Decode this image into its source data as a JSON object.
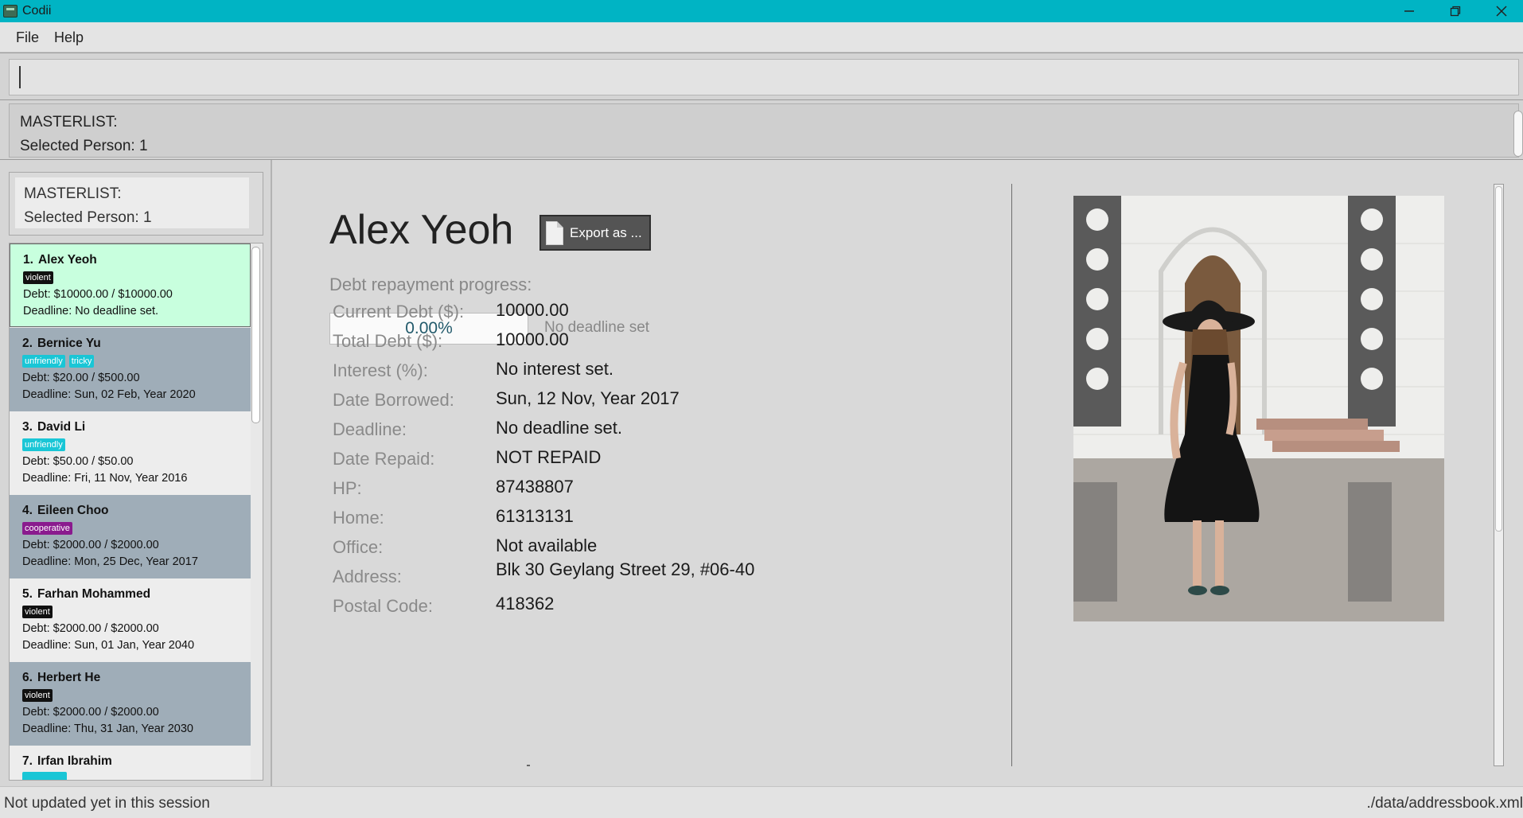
{
  "window": {
    "title": "Codii"
  },
  "menu": {
    "file": "File",
    "help": "Help"
  },
  "command": {
    "value": ""
  },
  "result": {
    "line1": "MASTERLIST:",
    "line2": "Selected Person: 1"
  },
  "mini_result": {
    "line1": "MASTERLIST:",
    "line2": "Selected Person: 1"
  },
  "persons": [
    {
      "index": "1.",
      "name": "Alex Yeoh",
      "tags": [
        {
          "label": "violent",
          "color": "#111111"
        }
      ],
      "debt": "Debt: $10000.00 / $10000.00",
      "deadline": "Deadline: No deadline set."
    },
    {
      "index": "2.",
      "name": "Bernice Yu",
      "tags": [
        {
          "label": "unfriendly",
          "color": "#19c6d6"
        },
        {
          "label": "tricky",
          "color": "#19c6d6"
        }
      ],
      "debt": "Debt: $20.00 / $500.00",
      "deadline": "Deadline: Sun, 02 Feb, Year 2020"
    },
    {
      "index": "3.",
      "name": "David Li",
      "tags": [
        {
          "label": "unfriendly",
          "color": "#19c6d6"
        }
      ],
      "debt": "Debt: $50.00 / $50.00",
      "deadline": "Deadline: Fri, 11 Nov, Year 2016"
    },
    {
      "index": "4.",
      "name": "Eileen Choo",
      "tags": [
        {
          "label": "cooperative",
          "color": "#8a1a8e"
        }
      ],
      "debt": "Debt: $2000.00 / $2000.00",
      "deadline": "Deadline: Mon, 25 Dec, Year 2017"
    },
    {
      "index": "5.",
      "name": "Farhan Mohammed",
      "tags": [
        {
          "label": "violent",
          "color": "#111111"
        }
      ],
      "debt": "Debt: $2000.00 / $2000.00",
      "deadline": "Deadline: Sun, 01 Jan, Year 2040"
    },
    {
      "index": "6.",
      "name": "Herbert He",
      "tags": [
        {
          "label": "violent",
          "color": "#111111"
        }
      ],
      "debt": "Debt: $2000.00 / $2000.00",
      "deadline": "Deadline: Thu, 31 Jan, Year 2030"
    },
    {
      "index": "7.",
      "name": "Irfan Ibrahim",
      "tags": [
        {
          "label": "",
          "color": "#19c6d6"
        }
      ],
      "debt": "",
      "deadline": ""
    }
  ],
  "details": {
    "name": "Alex Yeoh",
    "export_label": "Export as ...",
    "progress_title": "Debt repayment progress:",
    "progress_value": "0.00%",
    "progress_fraction": 0.0,
    "deadline_note": "No deadline set",
    "rows": [
      {
        "label": "Current Debt ($):",
        "value": "10000.00"
      },
      {
        "label": "Total Debt ($):",
        "value": "10000.00"
      },
      {
        "label": "Interest (%):",
        "value": "No interest set."
      },
      {
        "label": "Date Borrowed:",
        "value": "Sun, 12 Nov, Year 2017"
      },
      {
        "label": "Deadline:",
        "value": "No deadline set."
      },
      {
        "label": "Date Repaid:",
        "value": "NOT REPAID"
      },
      {
        "label": "HP:",
        "value": "87438807"
      },
      {
        "label": "Home:",
        "value": "61313131"
      },
      {
        "label": "Office:",
        "value": "Not available"
      },
      {
        "label": "Address:",
        "value": "Blk 30 Geylang Street 29, #06-40"
      },
      {
        "label": "Postal Code:",
        "value": "418362"
      }
    ]
  },
  "status": {
    "left": "Not updated yet in this session",
    "right": "./data/addressbook.xml"
  },
  "colors": {
    "titlebar": "#00b4c4",
    "selected_card": "#c8ffde",
    "odd_card": "#9fadb8"
  }
}
